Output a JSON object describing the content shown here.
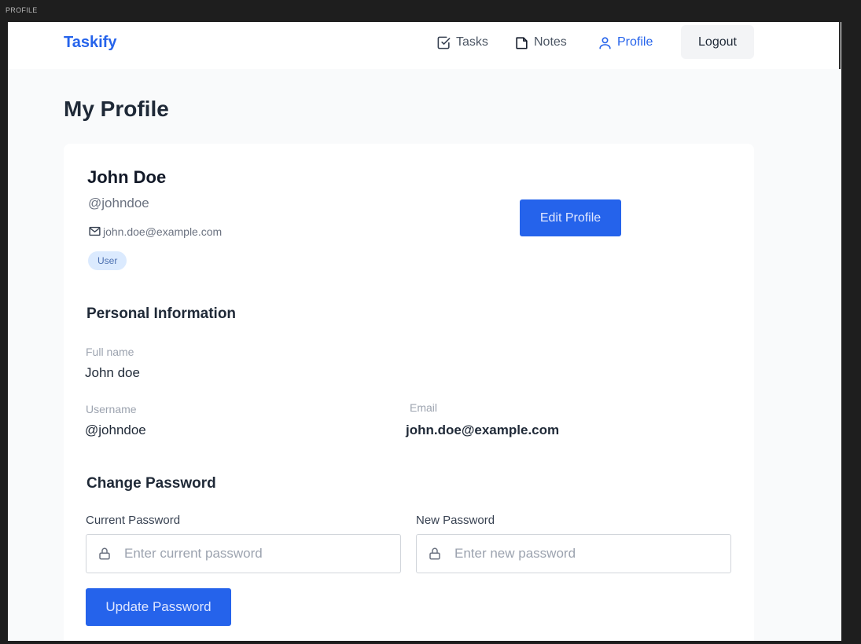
{
  "window": {
    "frame_label": "PROFILE"
  },
  "navbar": {
    "brand": "Taskify",
    "items": [
      {
        "label": "Tasks",
        "icon": "check-square-icon",
        "active": false
      },
      {
        "label": "Notes",
        "icon": "note-icon",
        "active": false
      },
      {
        "label": "Profile",
        "icon": "user-icon",
        "active": true
      }
    ],
    "logout_label": "Logout"
  },
  "page": {
    "title": "My Profile"
  },
  "profile": {
    "name": "John Doe",
    "handle": "@johndoe",
    "email": "john.doe@example.com",
    "role": "User",
    "edit_label": "Edit Profile"
  },
  "personal_info": {
    "heading": "Personal Information",
    "full_name_label": "Full name",
    "full_name_value": "John doe",
    "username_label": "Username",
    "username_value": "@johndoe",
    "email_label": "Email",
    "email_value": "john.doe@example.com"
  },
  "change_password": {
    "heading": "Change Password",
    "current_label": "Current Password",
    "current_placeholder": "Enter current password",
    "new_label": "New Password",
    "new_placeholder": "Enter new password",
    "submit_label": "Update Password"
  },
  "colors": {
    "accent": "#2563eb",
    "badge_bg": "#dbeafe",
    "page_bg": "#f9fafb"
  }
}
